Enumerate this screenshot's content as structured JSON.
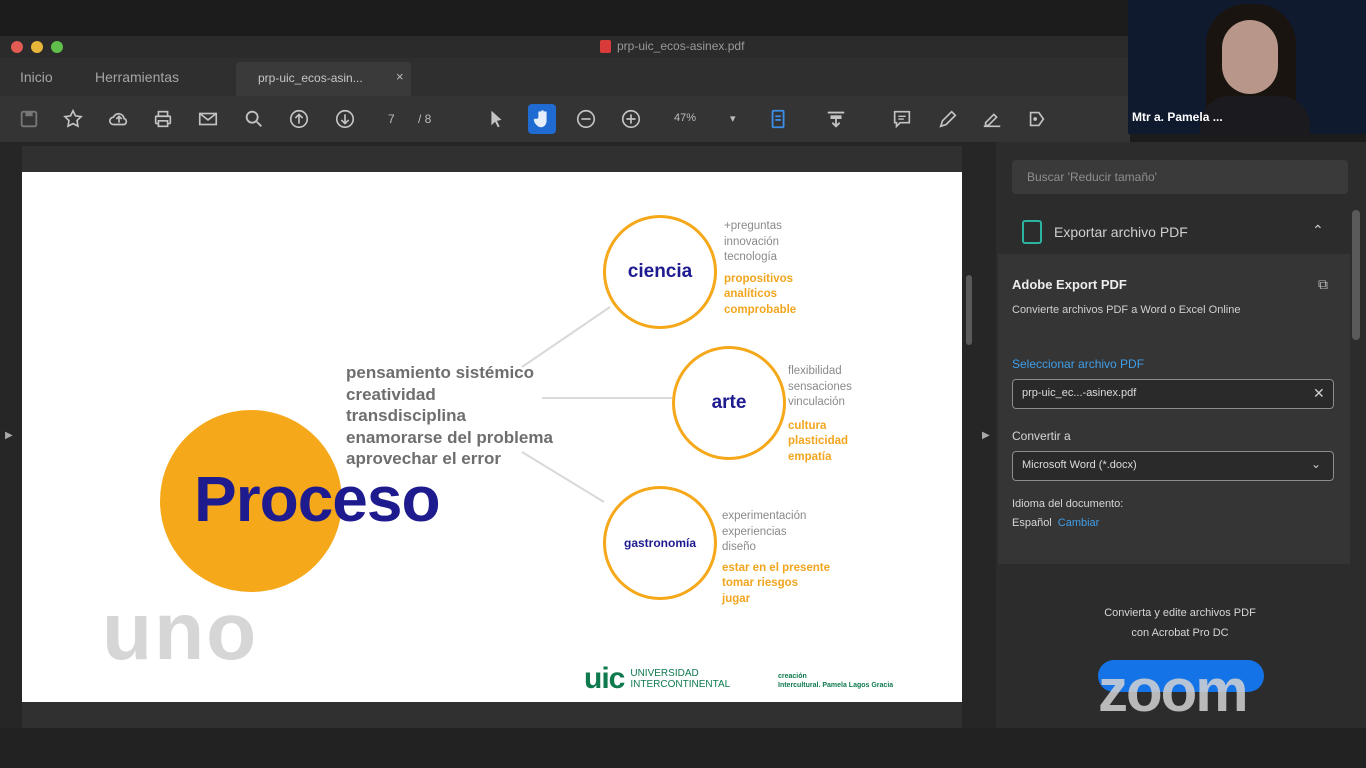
{
  "window": {
    "doc_title": "prp-uic_ecos-asinex.pdf",
    "traffic_colors": [
      "#e25c54",
      "#e6b53a",
      "#5fbf4a"
    ]
  },
  "tabs": {
    "home": "Inicio",
    "tools": "Herramientas",
    "document": "prp-uic_ecos-asin...",
    "close": "×"
  },
  "toolbar": {
    "page_current": "7",
    "page_total": "/ 8",
    "zoom": "47%",
    "zoom_caret": "▾"
  },
  "slide": {
    "ghost_word": "uno",
    "main_word": "Proceso",
    "concepts": [
      "pensamiento sistémico",
      "creatividad",
      "transdisciplina",
      "enamorarse del problema",
      "aprovechar el error"
    ],
    "nodes": [
      {
        "label": "ciencia",
        "gray": [
          "+preguntas",
          "innovación",
          "tecnología"
        ],
        "orange": [
          "propositivos",
          "analíticos",
          "comprobable"
        ]
      },
      {
        "label": "arte",
        "gray": [
          "flexibilidad",
          "sensaciones",
          "vinculación"
        ],
        "orange": [
          "cultura",
          "plasticidad",
          "empatía"
        ]
      },
      {
        "label": "gastronomía",
        "gray": [
          "experimentación",
          "experiencias",
          "diseño"
        ],
        "orange": [
          "estar en el presente",
          "tomar riesgos",
          "jugar"
        ]
      }
    ],
    "logo_mark": "uic",
    "logo_name_1": "UNIVERSIDAD",
    "logo_name_2": "INTERCONTINENTAL",
    "credit_1": "creación",
    "credit_2": "Intercultural. Pamela Lagos Gracia"
  },
  "right_panel": {
    "search_placeholder": "Buscar 'Reducir tamaño'",
    "export_title": "Exportar archivo PDF",
    "adobe_title": "Adobe Export PDF",
    "adobe_subtitle": "Convierte archivos PDF a Word o Excel Online",
    "select_label": "Seleccionar archivo PDF",
    "file_value": "prp-uic_ec...-asinex.pdf",
    "convert_label": "Convertir a",
    "convert_value": "Microsoft Word (*.docx)",
    "lang_label": "Idioma del documento:",
    "lang_value": "Español",
    "lang_change": "Cambiar",
    "promo_1": "Convierta y edite archivos PDF",
    "promo_2": "con Acrobat Pro DC"
  },
  "video": {
    "participant_name": "Mtr a. Pamela ...",
    "watermark": "zoom"
  }
}
